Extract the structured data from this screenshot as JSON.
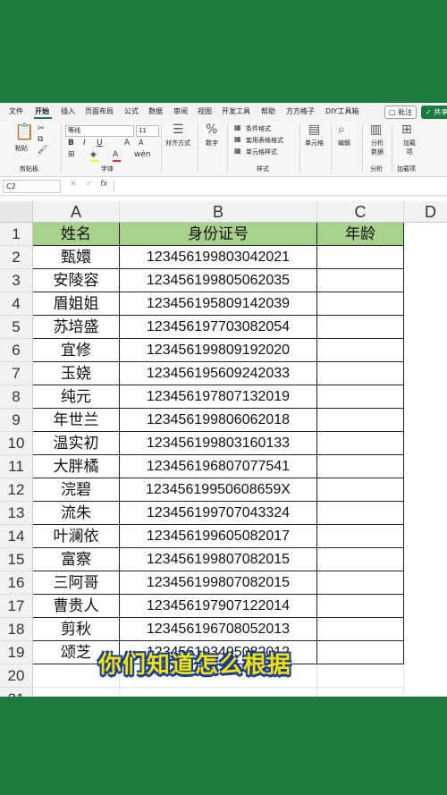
{
  "ribbon": {
    "tabs": [
      "文件",
      "开始",
      "插入",
      "页面布局",
      "公式",
      "数据",
      "审阅",
      "视图",
      "开发工具",
      "帮助",
      "方方格子",
      "DIY工具箱"
    ],
    "active_tab": "开始",
    "comment_label": "批注",
    "share_label": "共享",
    "paste_label": "粘贴",
    "clipboard_group": "剪贴板",
    "font_name": "等线",
    "font_size": "11",
    "font_group": "字体",
    "bold": "B",
    "italic": "I",
    "underline": "U",
    "align_label": "对齐方式",
    "number_label": "数字",
    "cond_format": "条件格式",
    "table_format": "套用表格格式",
    "cell_style": "单元格样式",
    "style_group": "样式",
    "cells_label": "单元格",
    "edit_label": "编辑",
    "analyze_label": "分析数据",
    "analyze_group": "分析",
    "addin_label": "加载项",
    "addin_group": "加载项"
  },
  "formula_bar": {
    "name_box": "C2",
    "fx": "fx",
    "value": ""
  },
  "columns": [
    "A",
    "B",
    "C",
    "D"
  ],
  "rows": [
    "1",
    "2",
    "3",
    "4",
    "5",
    "6",
    "7",
    "8",
    "9",
    "10",
    "11",
    "12",
    "13",
    "14",
    "15",
    "16",
    "17",
    "18",
    "19",
    "20",
    "21"
  ],
  "table": {
    "header": [
      "姓名",
      "身份证号",
      "年龄"
    ],
    "data": [
      [
        "甄嬛",
        "123456199803042021"
      ],
      [
        "安陵容",
        "123456199805062035"
      ],
      [
        "眉姐姐",
        "123456195809142039"
      ],
      [
        "苏培盛",
        "123456197703082054"
      ],
      [
        "宜修",
        "123456199809192020"
      ],
      [
        "玉娆",
        "123456195609242033"
      ],
      [
        "纯元",
        "123456197807132019"
      ],
      [
        "年世兰",
        "123456199806062018"
      ],
      [
        "温实初",
        "123456199803160133"
      ],
      [
        "大胖橘",
        "123456196807077541"
      ],
      [
        "浣碧",
        "12345619950608659X"
      ],
      [
        "流朱",
        "123456199707043324"
      ],
      [
        "叶澜依",
        "123456199605082017"
      ],
      [
        "富察",
        "123456199807082015"
      ],
      [
        "三阿哥",
        "123456199807082015"
      ],
      [
        "曹贵人",
        "123456197907122014"
      ],
      [
        "剪秋",
        "123456196708052013"
      ],
      [
        "颂芝",
        "123456193405082012"
      ]
    ]
  },
  "subtitle": "你们知道怎么根据",
  "colors": {
    "background": "#1c7a3f",
    "header_fill": "#a9d18e",
    "subtitle_text": "#f2e300",
    "subtitle_outline": "#1a3a9a"
  }
}
